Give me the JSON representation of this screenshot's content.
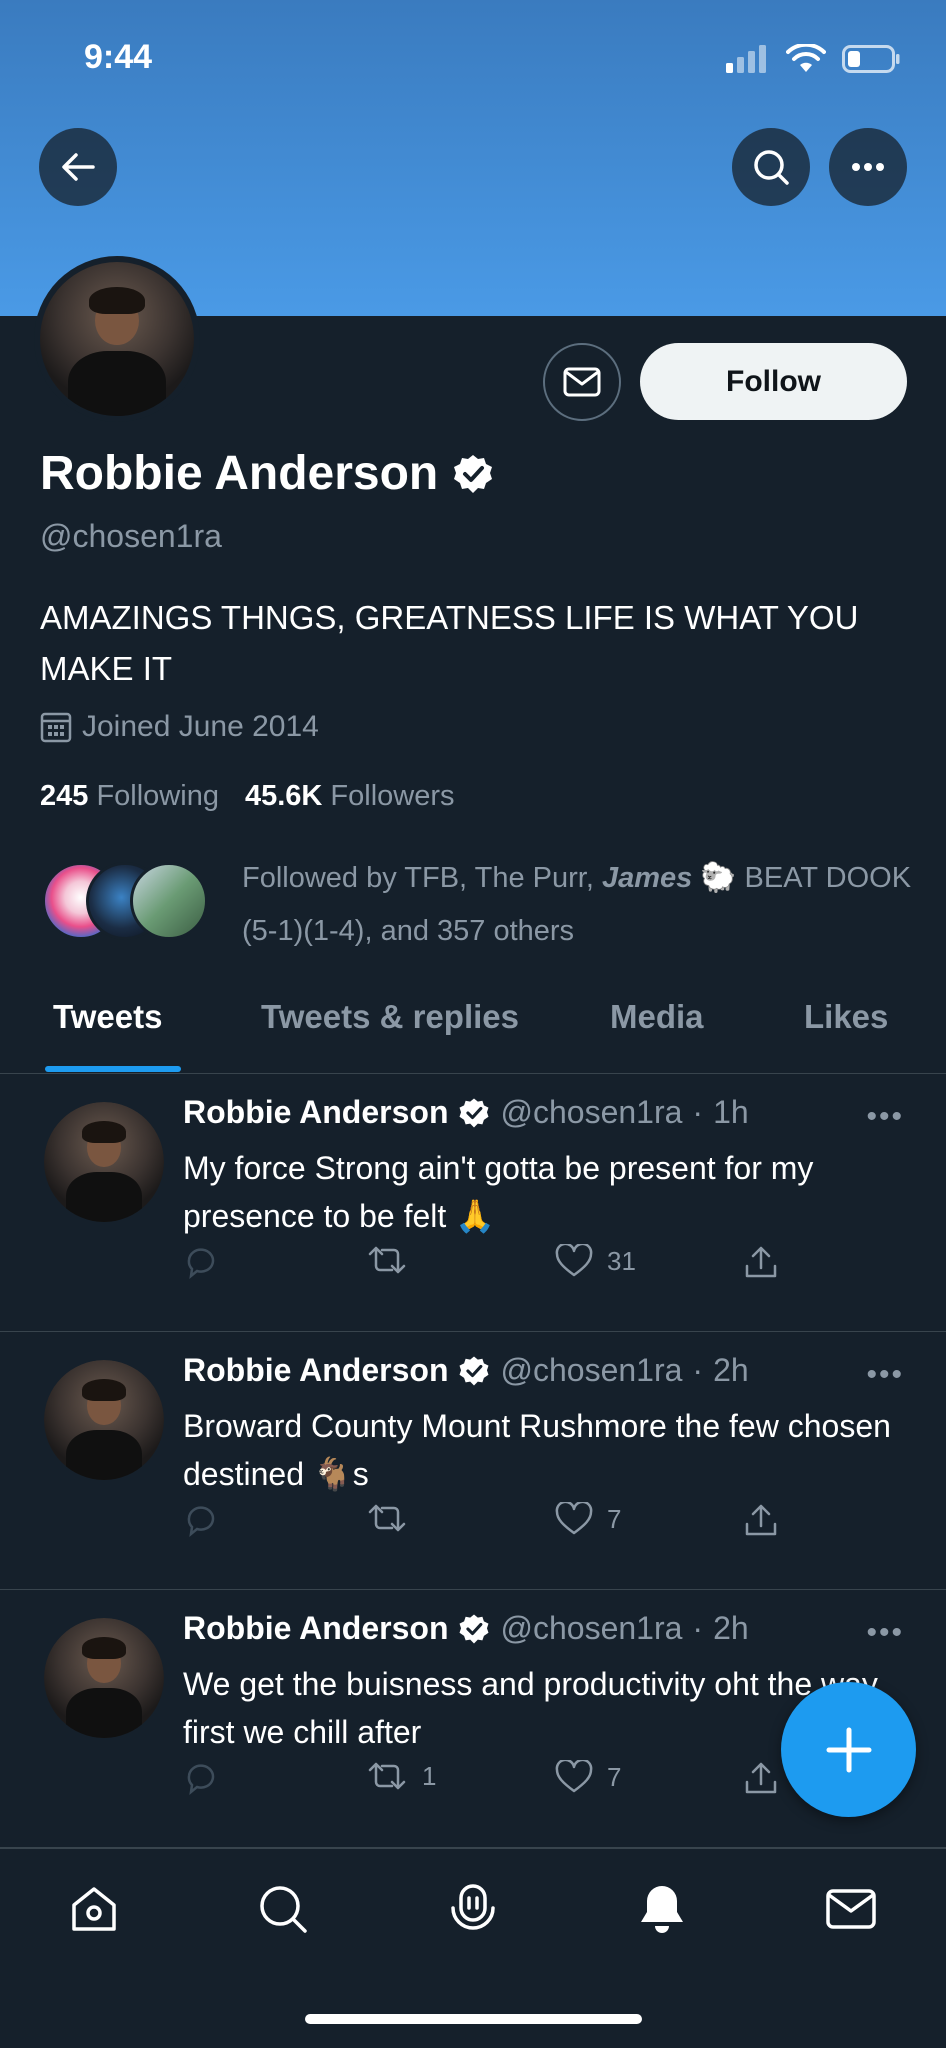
{
  "status_bar": {
    "time": "9:44"
  },
  "profile": {
    "name": "Robbie Anderson",
    "handle": "@chosen1ra",
    "bio": "AMAZINGS THNGS, GREATNESS LIFE IS WHAT YOU MAKE IT",
    "joined": "Joined June 2014",
    "following_count": "245",
    "following_label": "Following",
    "followers_count": "45.6K",
    "followers_label": "Followers",
    "followed_by_prefix": "Followed by TFB, The Purr, ",
    "followed_by_james": "James",
    "followed_by_emoji": "🐑",
    "followed_by_suffix": " BEAT DOOK (5-1)(1-4), and 357 others",
    "follow_button": "Follow"
  },
  "tabs": [
    {
      "label": "Tweets"
    },
    {
      "label": "Tweets & replies"
    },
    {
      "label": "Media"
    },
    {
      "label": "Likes"
    }
  ],
  "tweets": [
    {
      "name": "Robbie Anderson",
      "handle": "@chosen1ra",
      "sep": "·",
      "time": "1h",
      "text": "My force Strong ain't gotta be present for my presence to be felt 🙏",
      "retweets": "",
      "likes": "31"
    },
    {
      "name": "Robbie Anderson",
      "handle": "@chosen1ra",
      "sep": "·",
      "time": "2h",
      "text": "Broward County Mount Rushmore the few chosen destined 🐐s",
      "retweets": "",
      "likes": "7"
    },
    {
      "name": "Robbie Anderson",
      "handle": "@chosen1ra",
      "sep": "·",
      "time": "2h",
      "text": "We get the buisness and productivity oht the way first we chill after",
      "retweets": "1",
      "likes": "7"
    }
  ],
  "colors": {
    "background": "#15202b",
    "accent": "#1d9bf0",
    "secondary_text": "#8b98a5",
    "banner": "#4a9ae6"
  }
}
